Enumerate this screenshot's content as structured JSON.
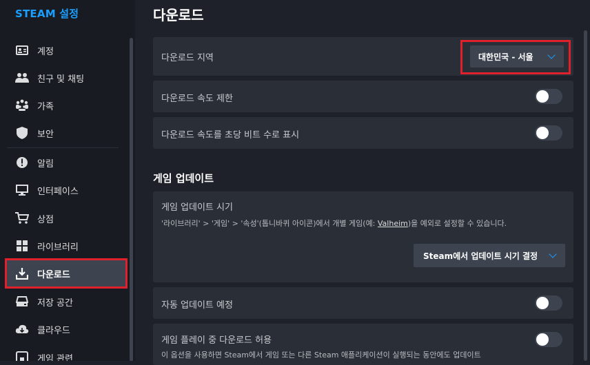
{
  "sidebar": {
    "title": "STEAM 설정",
    "items": [
      {
        "label": "계정",
        "icon": "account-icon"
      },
      {
        "label": "친구 및 채팅",
        "icon": "friends-icon"
      },
      {
        "label": "가족",
        "icon": "family-icon"
      },
      {
        "label": "보안",
        "icon": "shield-icon"
      },
      {
        "label": "알림",
        "icon": "notification-icon"
      },
      {
        "label": "인터페이스",
        "icon": "monitor-icon"
      },
      {
        "label": "상점",
        "icon": "cart-icon"
      },
      {
        "label": "라이브러리",
        "icon": "grid-icon"
      },
      {
        "label": "다운로드",
        "icon": "download-icon",
        "active": true
      },
      {
        "label": "저장 공간",
        "icon": "storage-icon"
      },
      {
        "label": "클라우드",
        "icon": "cloud-icon"
      },
      {
        "label": "게임 관련",
        "icon": "game-icon"
      }
    ]
  },
  "main": {
    "title": "다운로드",
    "download_region": {
      "label": "다운로드 지역",
      "value": "대한민국 - 서울"
    },
    "limit_speed": {
      "label": "다운로드 속도 제한",
      "on": false
    },
    "bits_per_second": {
      "label": "다운로드 속도를 초당 비트 수로 표시",
      "on": false
    },
    "game_updates": {
      "section_title": "게임 업데이트",
      "timing_label": "게임 업데이트 시기",
      "timing_desc_before": "'라이브러리' > '게임' > '속성'(톱니바퀴 아이콘)에서 개별 게임(예: ",
      "timing_desc_link": "Valheim",
      "timing_desc_after": ")을 예외로 설정할 수 있습니다.",
      "timing_value": "Steam에서 업데이트 시기 결정"
    },
    "scheduled": {
      "label": "자동 업데이트 예정",
      "on": false
    },
    "allow_during_play": {
      "label": "게임 플레이 중 다운로드 허용",
      "desc": "이 옵션을 사용하면 Steam에서 게임 또는 다른 Steam 애플리케이션이 실행되는 동안에도 업데이트",
      "on": false
    }
  },
  "colors": {
    "accent": "#1a9fff",
    "highlight": "#e0202a",
    "row_bg": "#2a2e36",
    "sidebar_bg": "#181b21"
  }
}
